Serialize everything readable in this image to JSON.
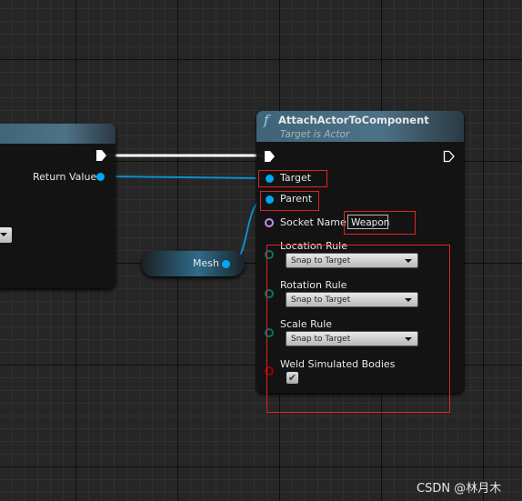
{
  "left_node": {
    "return_value_label": "Return Value"
  },
  "mesh_node": {
    "label": "Mesh"
  },
  "attach_node": {
    "function_icon": "f",
    "title": "AttachActorToComponent",
    "subtitle": "Target is Actor",
    "target_label": "Target",
    "parent_label": "Parent",
    "socket_name_label": "Socket Name",
    "socket_name_value": "Weapon",
    "location_rule_label": "Location Rule",
    "location_rule_value": "Snap to Target",
    "rotation_rule_label": "Rotation Rule",
    "rotation_rule_value": "Snap to Target",
    "scale_rule_label": "Scale Rule",
    "scale_rule_value": "Snap to Target",
    "weld_label": "Weld Simulated Bodies",
    "weld_checked": true
  },
  "watermark": "CSDN @林月木",
  "colors": {
    "object_pin": "#00a8f4",
    "name_pin": "#c58cf0",
    "enum_pin": "#00736a",
    "bool_pin": "#950000",
    "highlight": "#e02424"
  }
}
